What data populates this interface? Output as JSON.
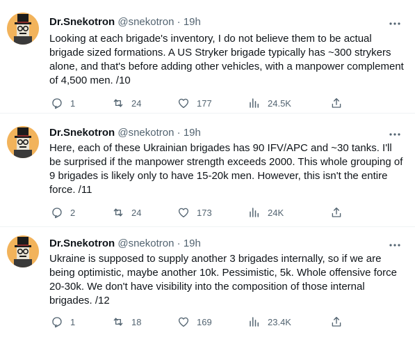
{
  "tweets": [
    {
      "name": "Dr.Snekotron",
      "handle": "@snekotron",
      "separator": "·",
      "time": "19h",
      "text": "Looking at each brigade's inventory, I do not believe them to be actual brigade sized formations. A US Stryker brigade typically has ~300 strykers alone, and that's before adding other vehicles, with a manpower complement of 4,500 men. /10",
      "replies": "1",
      "retweets": "24",
      "likes": "177",
      "views": "24.5K"
    },
    {
      "name": "Dr.Snekotron",
      "handle": "@snekotron",
      "separator": "·",
      "time": "19h",
      "text": "Here, each of these Ukrainian brigades has 90 IFV/APC and ~30 tanks. I'll be surprised if the manpower strength exceeds 2000. This whole grouping of 9 brigades is likely only to have 15-20k men. However, this isn't the entire force. /11",
      "replies": "2",
      "retweets": "24",
      "likes": "173",
      "views": "24K"
    },
    {
      "name": "Dr.Snekotron",
      "handle": "@snekotron",
      "separator": "·",
      "time": "19h",
      "text": "Ukraine is supposed to supply another 3 brigades internally, so if we are being optimistic, maybe another 10k. Pessimistic, 5k. Whole offensive force 20-30k. We don't have visibility into the composition of those internal brigades. /12",
      "replies": "1",
      "retweets": "18",
      "likes": "169",
      "views": "23.4K"
    }
  ],
  "icons": {
    "reply": "reply-icon",
    "retweet": "retweet-icon",
    "like": "like-icon",
    "views": "views-icon",
    "share": "share-icon",
    "more": "more-icon"
  },
  "colors": {
    "secondary_text": "#536471",
    "primary_text": "#0f1419",
    "avatar_background": "#f2b35b",
    "separator": "#eff3f4"
  }
}
